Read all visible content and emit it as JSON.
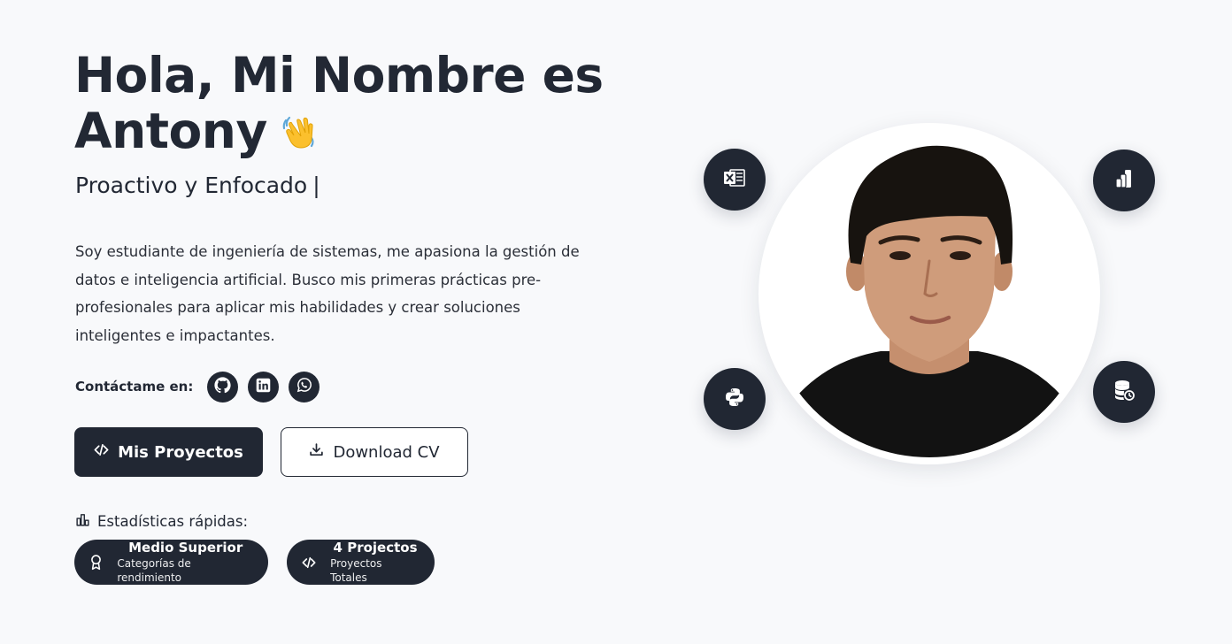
{
  "hero": {
    "title_line1": "Hola, Mi Nombre es",
    "title_line2": "Antony",
    "wave_emoji": "waving-hand",
    "subtitle": "Proactivo y Enfocado",
    "cursor": "|",
    "description": "Soy estudiante de ingeniería de sistemas, me apasiona la gestión de datos e inteligencia artificial. Busco mis primeras prácticas pre-profesionales para aplicar mis habilidades y crear soluciones inteligentes e impactantes."
  },
  "contact": {
    "label": "Contáctame en:",
    "links": [
      {
        "icon": "github-icon"
      },
      {
        "icon": "linkedin-icon"
      },
      {
        "icon": "whatsapp-icon"
      }
    ]
  },
  "actions": {
    "projects_label": "Mis Proyectos",
    "download_label": "Download CV"
  },
  "stats": {
    "title": "Estadísticas rápidas:",
    "items": [
      {
        "value": "Medio Superior",
        "caption": "Categorías de rendimiento",
        "icon": "award-icon"
      },
      {
        "value": "4 Projectos",
        "caption": "Proyectos Totales",
        "icon": "code-icon"
      }
    ]
  },
  "tech_badges": [
    {
      "icon": "excel-icon"
    },
    {
      "icon": "powerbi-icon"
    },
    {
      "icon": "python-icon"
    },
    {
      "icon": "database-icon"
    }
  ],
  "colors": {
    "background": "#f8f9fb",
    "primary": "#212733",
    "text": "#222834"
  }
}
